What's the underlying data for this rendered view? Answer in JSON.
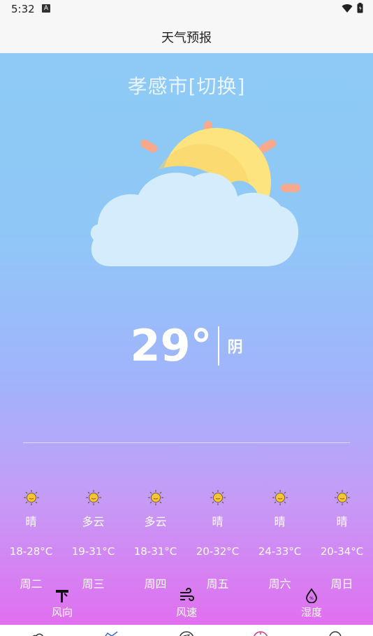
{
  "status_bar": {
    "time": "5:32",
    "notification_icon": "a-letter-icon",
    "right_icons": [
      "wifi-icon",
      "battery-icon"
    ]
  },
  "app_bar": {
    "title": "天气预报"
  },
  "main": {
    "city": "孝感市[切换]",
    "temperature": "29°",
    "condition": "阴",
    "illustration": "cloud-sun-icon",
    "colors": {
      "gradient_top": "#8ecaf5",
      "gradient_bottom": "#e16ff0",
      "sun": "#fde47e",
      "cloud": "#d4ecfb",
      "rays": "#f6a98c"
    }
  },
  "forecast": [
    {
      "condition": "晴",
      "range": "18-28°C",
      "weekday": "周二",
      "icon": "sun-icon"
    },
    {
      "condition": "多云",
      "range": "19-31°C",
      "weekday": "周三",
      "icon": "sun-icon"
    },
    {
      "condition": "多云",
      "range": "18-31°C",
      "weekday": "周四",
      "icon": "sun-icon"
    },
    {
      "condition": "晴",
      "range": "20-32°C",
      "weekday": "周五",
      "icon": "sun-icon"
    },
    {
      "condition": "晴",
      "range": "24-33°C",
      "weekday": "周六",
      "icon": "sun-icon"
    },
    {
      "condition": "晴",
      "range": "20-34°C",
      "weekday": "周日",
      "icon": "sun-icon"
    }
  ],
  "details": [
    {
      "label": "风向",
      "icon": "wind-vane-icon"
    },
    {
      "label": "风速",
      "icon": "wind-icon"
    },
    {
      "label": "湿度",
      "icon": "drop-icon"
    }
  ],
  "bottom_nav": {
    "items": [
      "weather-icon",
      "map-icon",
      "compass-icon",
      "clock-icon",
      "search-icon"
    ]
  }
}
